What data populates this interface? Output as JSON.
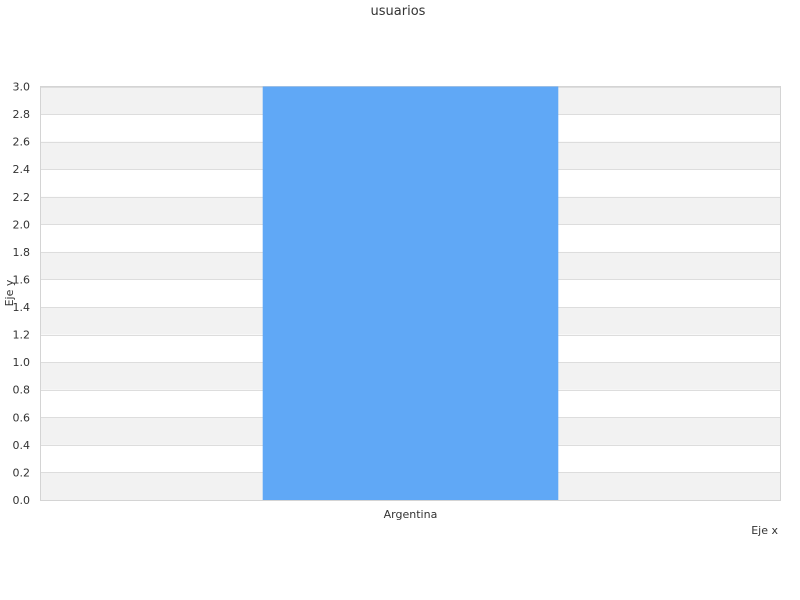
{
  "chart_data": {
    "type": "bar",
    "title": "usuarios",
    "xlabel": "Eje x",
    "ylabel": "Eje y",
    "categories": [
      "Argentina"
    ],
    "values": [
      3
    ],
    "ylim": [
      0,
      3
    ],
    "yticks": [
      "0.0",
      "0.2",
      "0.4",
      "0.6",
      "0.8",
      "1.0",
      "1.2",
      "1.4",
      "1.6",
      "1.8",
      "2.0",
      "2.2",
      "2.4",
      "2.6",
      "2.8",
      "3.0"
    ],
    "grid": true,
    "bar_color": "#60a8f6",
    "band_color": "#f2f2f2",
    "grid_color": "#dddddd"
  }
}
